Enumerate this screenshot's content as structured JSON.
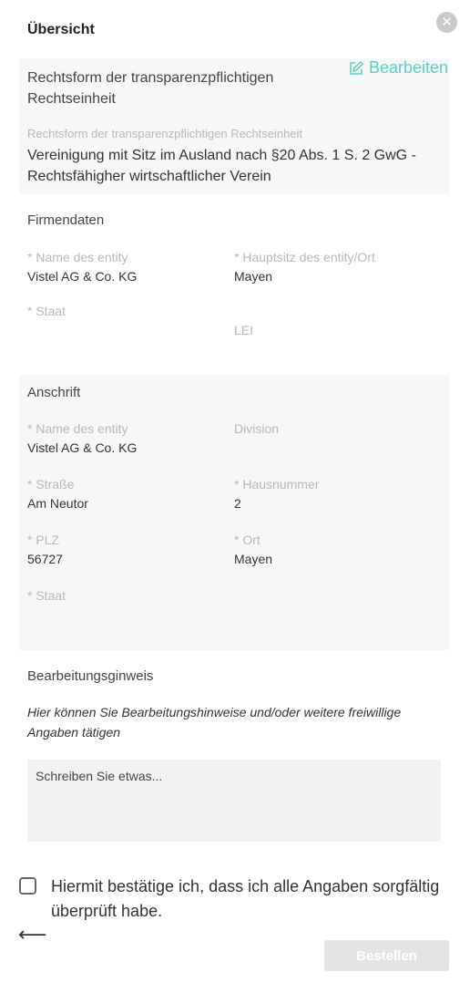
{
  "header": {
    "title": "Übersicht",
    "close_icon": "close-icon"
  },
  "legal_form": {
    "heading": "Rechtsform der transparenzpflichtigen Rechtseinheit",
    "edit_label": "Bearbeiten",
    "field_label": "Rechtsform der transparenzpflichtigen Rechtseinheit",
    "field_value": "Vereinigung mit Sitz im Ausland nach §20 Abs. 1 S. 2 GwG - Rechtsfähigher wirtschaftlicher Verein"
  },
  "company": {
    "heading": "Firmendaten",
    "name_label": "* Name des entity",
    "name_value": "Vistel AG & Co. KG",
    "hq_label": "* Hauptsitz des entity/Ort",
    "hq_value": "Mayen",
    "country_label": "* Staat",
    "lei_label": "LEI"
  },
  "address": {
    "heading": "Anschrift",
    "name_label": "* Name des entity",
    "name_value": "Vistel AG & Co. KG",
    "division_label": "Division",
    "street_label": "* Straße",
    "street_value": "Am Neutor",
    "number_label": "* Hausnummer",
    "number_value": "2",
    "zip_label": "* PLZ",
    "zip_value": "56727",
    "city_label": "* Ort",
    "city_value": "Mayen",
    "country_label": "* Staat"
  },
  "notes": {
    "heading": "Bearbeitungsginweis",
    "hint": "Hier können Sie Bearbeitungshinweise und/oder weitere freiwillige Angaben tätigen",
    "placeholder": "Schreiben Sie etwas..."
  },
  "confirm": {
    "label": "Hiermit bestätige ich, dass ich alle Angaben sorgfältig überprüft habe."
  },
  "footer": {
    "back_icon": "arrow-left-icon",
    "back_glyph": "⟵",
    "order_label": "Bestellen"
  }
}
